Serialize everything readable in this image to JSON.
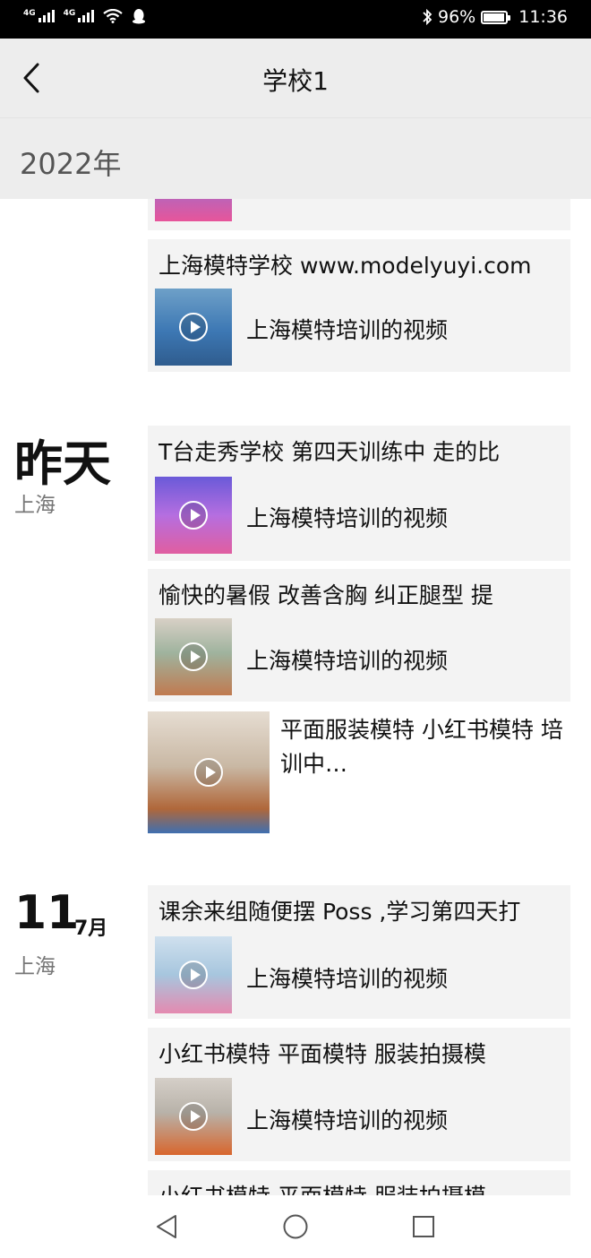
{
  "status_bar": {
    "net1": "4G",
    "net2": "4G",
    "battery": "96%",
    "time": "11:36"
  },
  "header": {
    "title": "学校1"
  },
  "year_section": {
    "label": "2022年"
  },
  "dates": {
    "yesterday": {
      "label": "昨天",
      "location": "上海"
    },
    "jul11": {
      "day": "11",
      "month": "7月",
      "location": "上海"
    }
  },
  "posts": [
    {
      "title": "",
      "video_label": ""
    },
    {
      "title": "上海模特学校 www.modelyuyi.com",
      "video_label": "上海模特培训的视频"
    },
    {
      "title": "T台走秀学校  第四天训练中 走的比",
      "video_label": "上海模特培训的视频"
    },
    {
      "title": "愉快的暑假  改善含胸 纠正腿型  提",
      "video_label": "上海模特培训的视频"
    },
    {
      "text": "平面服装模特  小红书模特  培训中…"
    },
    {
      "title": "课余来组随便摆 Poss ,学习第四天打",
      "video_label": "上海模特培训的视频"
    },
    {
      "title": "小红书模特  平面模特 服装拍摄模",
      "video_label": "上海模特培训的视频"
    },
    {
      "title": "小红书模特  平面模特 服装拍摄模"
    }
  ],
  "nav": {
    "back": "back-icon",
    "home": "home-icon",
    "recent": "recent-apps-icon"
  }
}
